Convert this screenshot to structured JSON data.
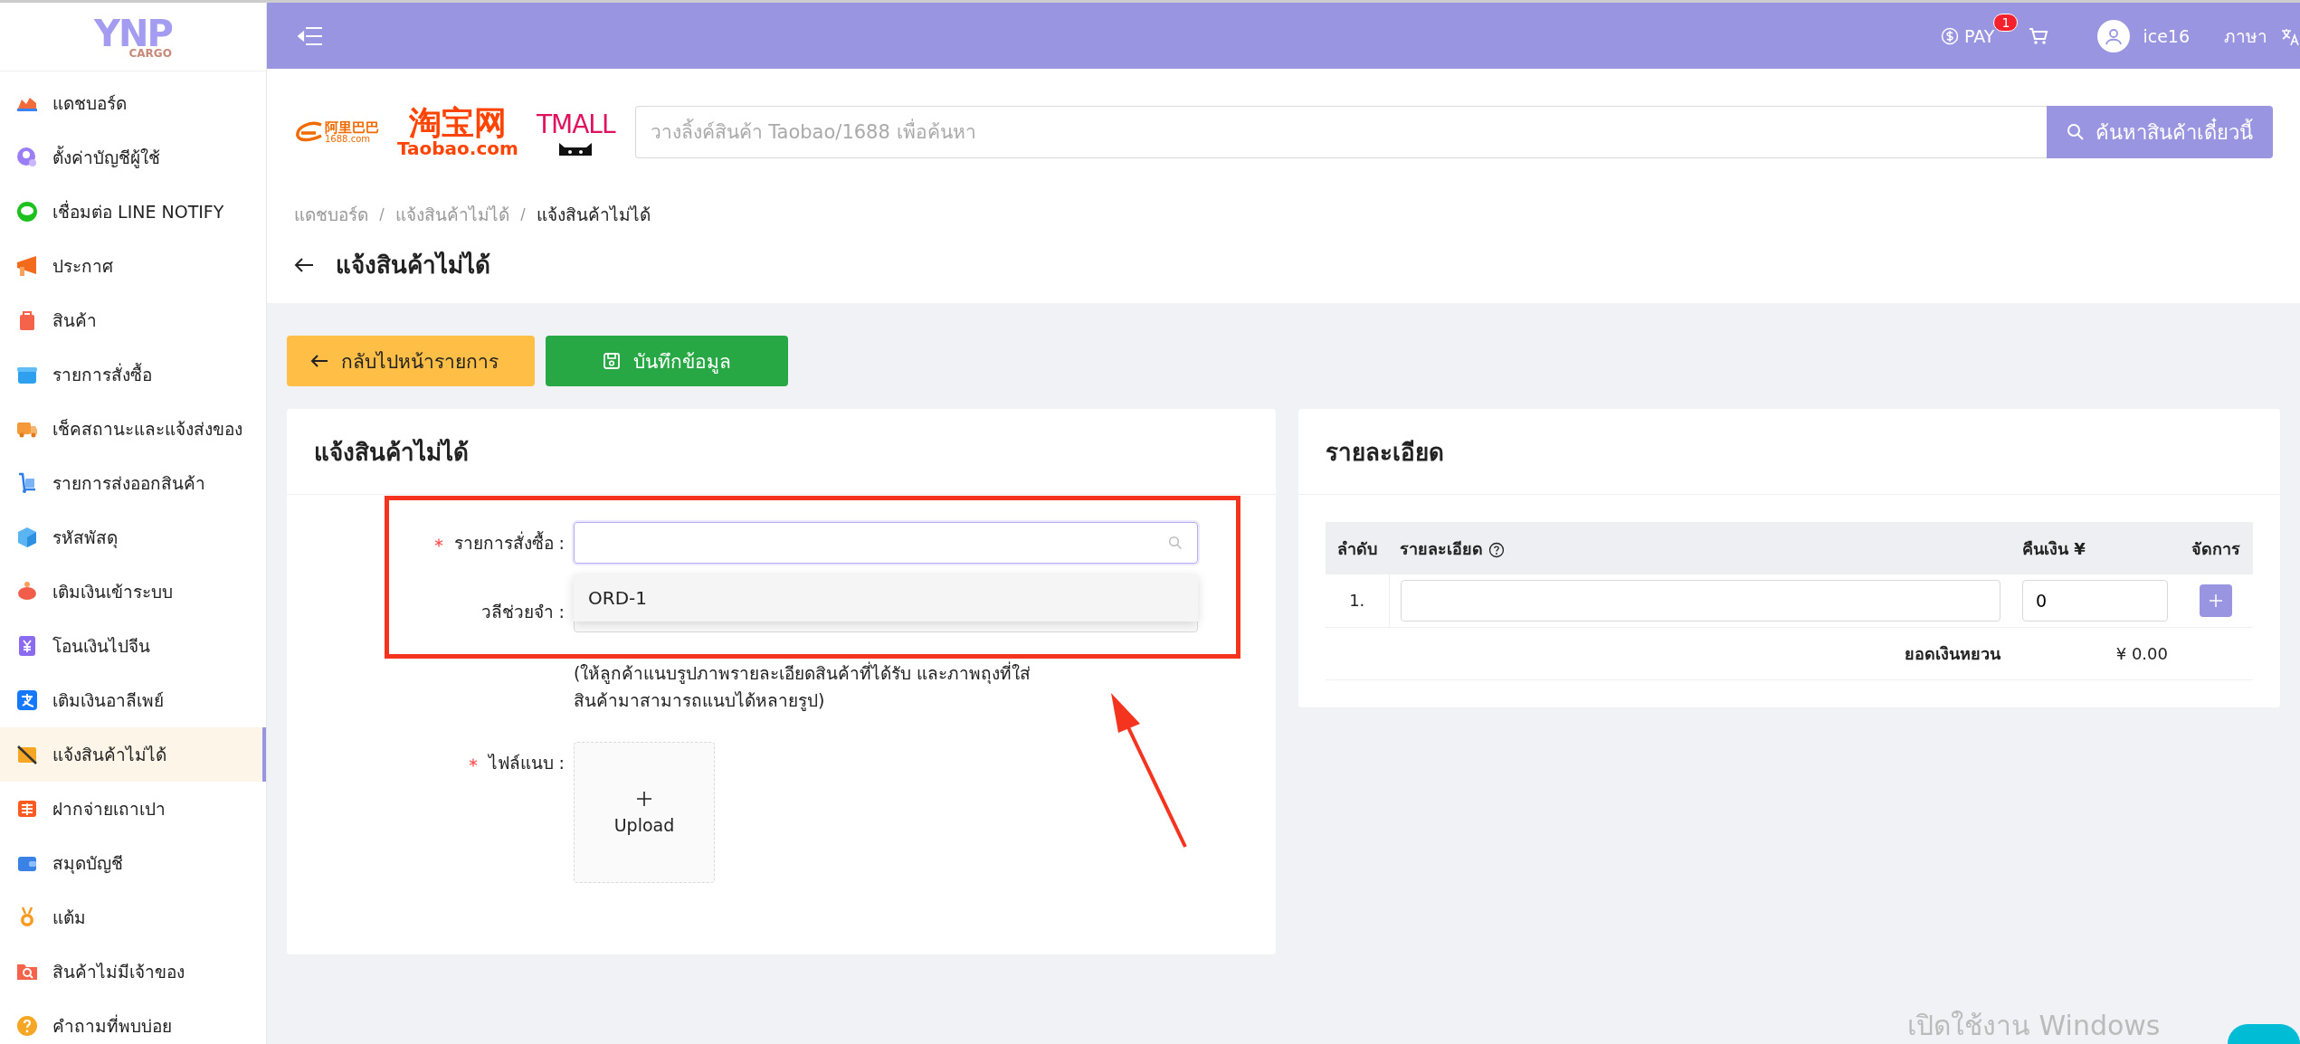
{
  "sidebar": {
    "logo": {
      "text": "YNP",
      "subtext": "CARGO"
    },
    "items": [
      {
        "label": "แดชบอร์ด",
        "selected": false
      },
      {
        "label": "ตั้งค่าบัญชีผู้ใช้",
        "selected": false
      },
      {
        "label": "เชื่อมต่อ LINE NOTIFY",
        "selected": false
      },
      {
        "label": "ประกาศ",
        "selected": false
      },
      {
        "label": "สินค้า",
        "selected": false
      },
      {
        "label": "รายการสั่งซื้อ",
        "selected": false
      },
      {
        "label": "เช็คสถานะและแจ้งส่งของ",
        "selected": false
      },
      {
        "label": "รายการส่งออกสินค้า",
        "selected": false
      },
      {
        "label": "รหัสพัสดุ",
        "selected": false
      },
      {
        "label": "เติมเงินเข้าระบบ",
        "selected": false
      },
      {
        "label": "โอนเงินไปจีน",
        "selected": false
      },
      {
        "label": "เติมเงินอาลีเพย์",
        "selected": false
      },
      {
        "label": "แจ้งสินค้าไม่ได้",
        "selected": true
      },
      {
        "label": "ฝากจ่ายเถาเปา",
        "selected": false
      },
      {
        "label": "สมุดบัญชี",
        "selected": false
      },
      {
        "label": "แต้ม",
        "selected": false
      },
      {
        "label": "สินค้าไม่มีเจ้าของ",
        "selected": false
      },
      {
        "label": "คำถามที่พบบ่อย",
        "selected": false
      }
    ]
  },
  "topbar": {
    "pay": {
      "label": "PAY",
      "badge": "1"
    },
    "username": "ice16",
    "language": "ภาษา"
  },
  "marketplaces": {
    "alibaba": {
      "name": "阿里巴巴",
      "domain": "1688.com"
    },
    "taobao": {
      "name": "淘宝网",
      "domain": "Taobao.com"
    },
    "tmall": {
      "name": "TMALL"
    }
  },
  "search": {
    "placeholder": "วางลิ้งค์สินค้า Taobao/1688 เพื่อค้นหา",
    "button": "ค้นหาสินค้าเดี๋ยวนี้"
  },
  "breadcrumb": [
    {
      "label": "แดชบอร์ด",
      "current": false
    },
    {
      "label": "แจ้งสินค้าไม่ได้",
      "current": false
    },
    {
      "label": "แจ้งสินค้าไม่ได้",
      "current": true
    }
  ],
  "page_title": "แจ้งสินค้าไม่ได้",
  "actions": [
    {
      "label": "กลับไปหน้ารายการ",
      "kind": "back"
    },
    {
      "label": "บันทึกข้อมูล",
      "kind": "save"
    }
  ],
  "form": {
    "title": "แจ้งสินค้าไม่ได้",
    "order": {
      "label": "รายการสั่งซื้อ :",
      "required": true,
      "dropdown_open": true,
      "options": [
        "ORD-1"
      ]
    },
    "note": {
      "label": "วลีช่วยจำ :",
      "required": false
    },
    "hint": "(ให้ลูกค้าแนบรูปภาพรายละเอียดสินค้าที่ได้รับ และภาพถุงที่ใส่สินค้ามาสามารถแนบได้หลายรูป)",
    "attachment": {
      "label": "ไฟล์แนบ :",
      "required": true,
      "upload": "Upload"
    }
  },
  "details": {
    "title": "รายละเอียด",
    "columns": [
      "ลำดับ",
      "รายละเอียด",
      "คืนเงิน ¥",
      "จัดการ"
    ],
    "rows": [
      {
        "index": "1.",
        "refund": "0"
      }
    ],
    "total_label": "ยอดเงินหยวน",
    "total": "¥ 0.00"
  },
  "os_notice": "เปิดใช้งาน Windows"
}
